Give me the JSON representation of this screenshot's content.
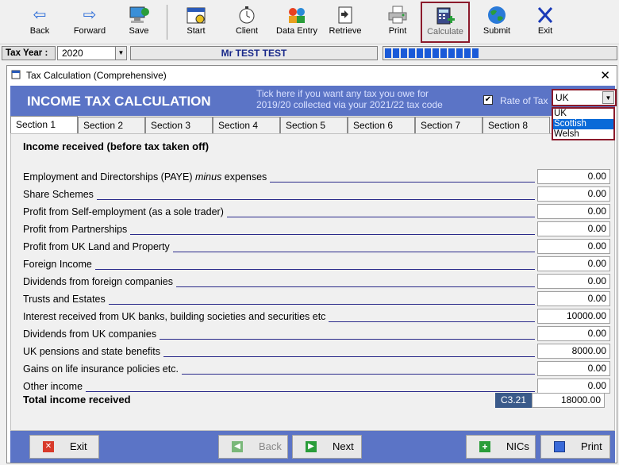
{
  "toolbar": {
    "back": "Back",
    "forward": "Forward",
    "save": "Save",
    "start": "Start",
    "client": "Client",
    "data_entry": "Data Entry",
    "retrieve": "Retrieve",
    "print": "Print",
    "calculate": "Calculate",
    "submit": "Submit",
    "exit": "Exit"
  },
  "taxbar": {
    "tax_year_label": "Tax Year :",
    "tax_year_value": "2020",
    "client_name": "Mr TEST TEST",
    "progress_segments": 12
  },
  "window": {
    "title": "Tax Calculation (Comprehensive)",
    "close": "✕"
  },
  "header": {
    "title": "INCOME TAX CALCULATION",
    "notice_line1": "Tick here if you want any tax you owe for",
    "notice_line2": "2019/20 collected via your 2021/22 tax code",
    "rate_label": "Rate of Tax",
    "rate_value": "UK",
    "rate_options": [
      "UK",
      "Scottish",
      "Welsh"
    ],
    "rate_highlighted": "Scottish",
    "checkbox_checked": true
  },
  "tabs": [
    "Section 1",
    "Section 2",
    "Section 3",
    "Section 4",
    "Section 5",
    "Section 6",
    "Section 7",
    "Section 8"
  ],
  "section": {
    "heading": "Income received (before tax taken off)",
    "rows": [
      {
        "label_pre": "Employment and Directorships (PAYE) ",
        "label_italic": "minus",
        "label_post": " expenses",
        "value": "0.00"
      },
      {
        "label_pre": "Share Schemes",
        "label_italic": "",
        "label_post": "",
        "value": "0.00"
      },
      {
        "label_pre": "Profit from Self-employment (as a sole trader)",
        "label_italic": "",
        "label_post": "",
        "value": "0.00"
      },
      {
        "label_pre": "Profit from Partnerships",
        "label_italic": "",
        "label_post": "",
        "value": "0.00"
      },
      {
        "label_pre": "Profit from UK Land and Property",
        "label_italic": "",
        "label_post": "",
        "value": "0.00"
      },
      {
        "label_pre": "Foreign Income",
        "label_italic": "",
        "label_post": "",
        "value": "0.00"
      },
      {
        "label_pre": "Dividends from foreign companies",
        "label_italic": "",
        "label_post": "",
        "value": "0.00"
      },
      {
        "label_pre": "Trusts and Estates",
        "label_italic": "",
        "label_post": "",
        "value": "0.00"
      },
      {
        "label_pre": "Interest received from UK banks, building societies and securities etc",
        "label_italic": "",
        "label_post": "",
        "value": "10000.00"
      },
      {
        "label_pre": "Dividends from UK companies",
        "label_italic": "",
        "label_post": "",
        "value": "0.00"
      },
      {
        "label_pre": "UK pensions and state benefits",
        "label_italic": "",
        "label_post": "",
        "value": "8000.00"
      },
      {
        "label_pre": "Gains on life insurance policies etc.",
        "label_italic": "",
        "label_post": "",
        "value": "0.00"
      },
      {
        "label_pre": "Other income",
        "label_italic": "",
        "label_post": "",
        "value": "0.00"
      }
    ],
    "total_label": "Total income received",
    "total_ref": "C3.21",
    "total_value": "18000.00"
  },
  "footer": {
    "exit": "Exit",
    "back": "Back",
    "next": "Next",
    "nics": "NICs",
    "print": "Print"
  },
  "colors": {
    "header_blue": "#5b74c6",
    "active_outline": "#8b1a2b",
    "ref_badge": "#3a5a8a"
  }
}
